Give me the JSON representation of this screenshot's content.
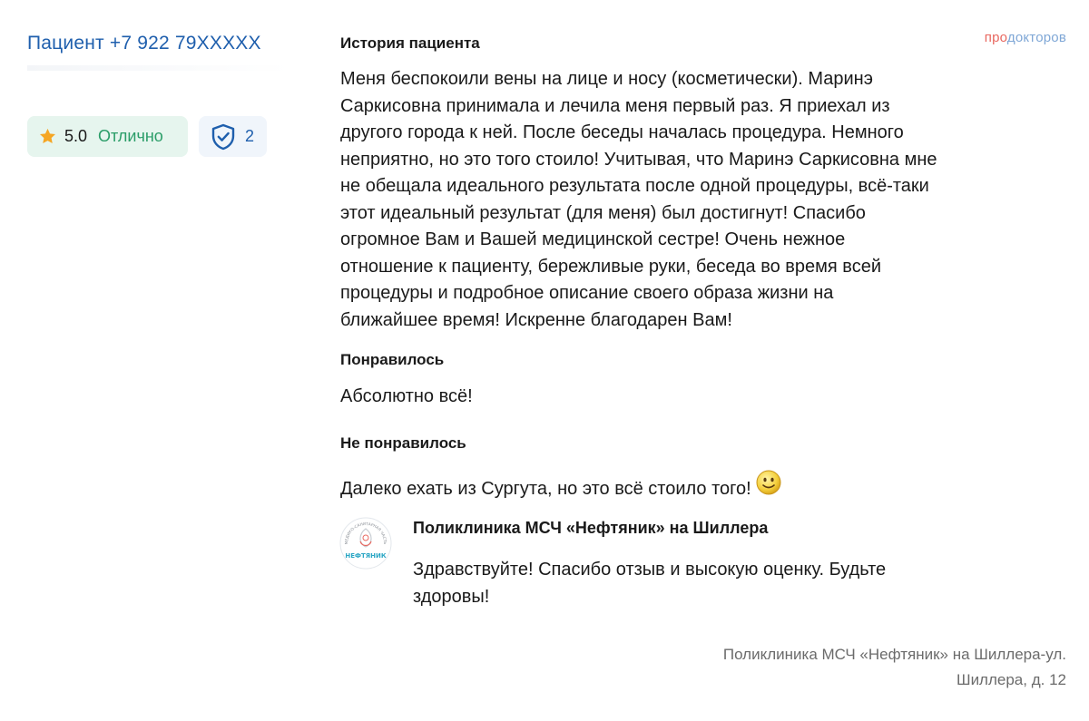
{
  "patient": {
    "name": "Пациент +7 922 79XXXXX"
  },
  "rating": {
    "score": "5.0",
    "label": "Отлично",
    "verified_count": "2"
  },
  "brand": {
    "part1": "про",
    "part2": "докторов"
  },
  "history": {
    "title": "История пациента",
    "lines": [
      "Меня беспокоили вены на лице и носу (косметически). Маринэ",
      "Саркисовна принимала и лечила меня первый раз. Я приехал из",
      "другого города к ней. После беседы началась процедура. Немного",
      "неприятно, но это того стоило! Учитывая, что Маринэ Саркисовна мне",
      "не обещала идеального результата после одной процедуры, всё-таки",
      "этот идеальный результат (для меня) был достигнут! Спасибо",
      "огромное Вам и Вашей медицинской сестре! Очень нежное",
      "отношение к пациенту, бережливые руки, беседа во время всей",
      "процедуры и подробное описание своего образа жизни на",
      "ближайшее время! Искренне благодарен Вам!"
    ]
  },
  "liked": {
    "title": "Понравилось",
    "text": "Абсолютно всё!"
  },
  "disliked": {
    "title": "Не понравилось",
    "text": "Далеко ехать из Сургута, но это всё стоило того!"
  },
  "reply": {
    "author": "Поликлиника МСЧ «Нефтяник» на Шиллера",
    "text_line1": "Здравствуйте! Спасибо отзыв и высокую оценку. Будьте",
    "text_line2": "здоровы!",
    "logo_text": "НЕФТЯНИК",
    "logo_ring_text": "МЕДИКО-САНИТАРНАЯ ЧАСТЬ"
  },
  "footer": {
    "line1": "Поликлиника МСЧ «Нефтяник» на Шиллера-ул.",
    "line2": "Шиллера, д. 12"
  },
  "colors": {
    "link": "#1f5fad",
    "rating_bg": "#e6f5ee",
    "rating_text": "#2a9d68",
    "star": "#f5a623",
    "brand_red": "#e8675f",
    "brand_blue": "#7fa7d6"
  }
}
